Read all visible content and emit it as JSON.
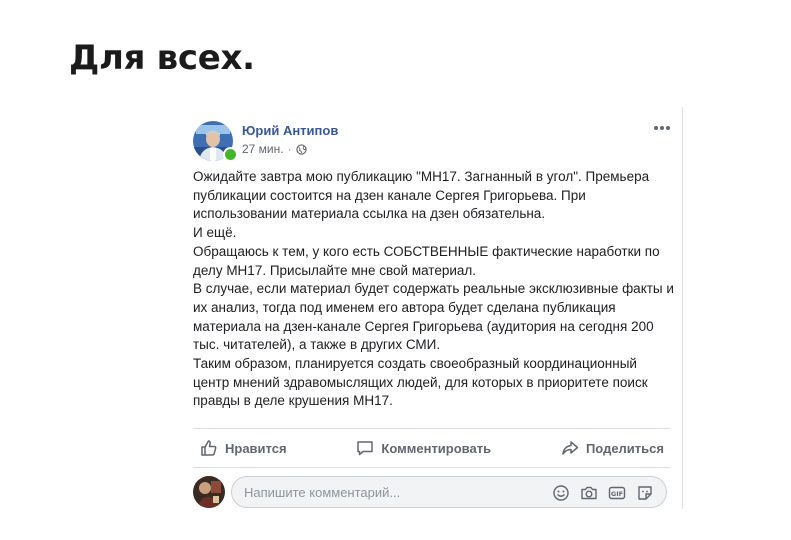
{
  "page": {
    "heading": "Для всех."
  },
  "post": {
    "author": "Юрий Антипов",
    "time": "27 мин.",
    "separator": "·",
    "privacy_icon": "globe-icon",
    "more_icon": "more-icon",
    "paragraphs": [
      "Ожидайте завтра мою публикацию \"МН17. Загнанный в угол\". Премьера публикации состоится на дзен канале Сергея Григорьева. При использовании материала ссылка на дзен обязательна.",
      "И ещё.",
      "Обращаюсь к тем, у кого есть СОБСТВЕННЫЕ фактические наработки по делу МН17. Присылайте мне свой материал.",
      "В случае, если материал будет содержать реальные эксклюзивные факты и их анализ, тогда под именем его автора будет сделана публикация материала на дзен-канале Сергея Григорьева (аудитория на сегодня 200 тыс. читателей), а также в других СМИ.",
      "Таким образом, планируется создать своеобразный координационный центр мнений здравомыслящих людей, для которых в приоритете поиск правды в деле крушения МН17."
    ],
    "actions": {
      "like": "Нравится",
      "comment": "Комментировать",
      "share": "Поделиться"
    }
  },
  "comment_box": {
    "placeholder": "Напишите комментарий...",
    "icons": [
      "emoji-icon",
      "camera-icon",
      "gif-icon",
      "sticker-icon"
    ]
  },
  "colors": {
    "author": "#385898",
    "text": "#1c1e21",
    "muted": "#616770",
    "online": "#42b72a"
  }
}
